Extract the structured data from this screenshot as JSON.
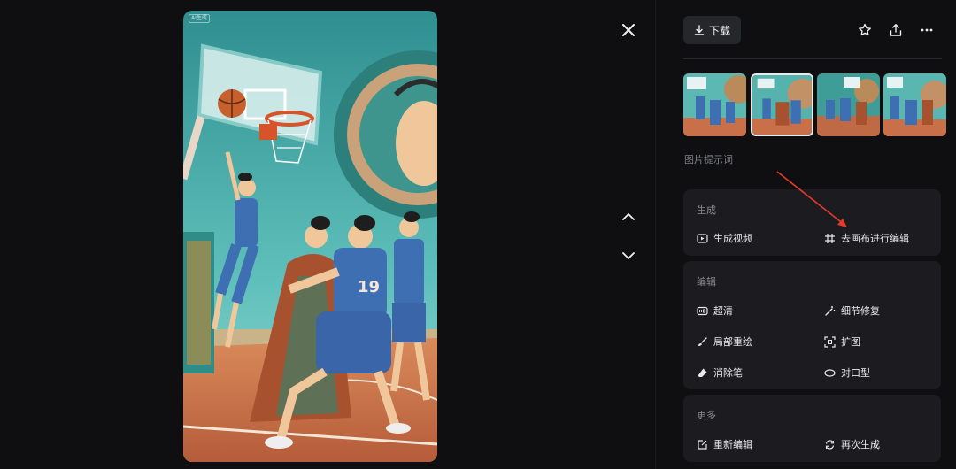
{
  "image": {
    "badge": "AI生成",
    "jersey_number": "19",
    "description_colors": {
      "sky": "#4fb3b0",
      "court": "#c8704a",
      "jersey": "#3f6fb3"
    }
  },
  "viewer": {
    "close_icon": "close-icon",
    "prev_icon": "chevron-up-icon",
    "next_icon": "chevron-down-icon"
  },
  "toolbar": {
    "download_label": "下载",
    "favorite_icon": "star-icon",
    "share_icon": "share-icon",
    "more_icon": "more-icon"
  },
  "thumbnails": [
    {
      "selected": false
    },
    {
      "selected": true
    },
    {
      "selected": false
    },
    {
      "selected": false
    }
  ],
  "prompt_label": "图片提示词",
  "sections": {
    "generate": {
      "title": "生成",
      "items": [
        "生成视频",
        "去画布进行编辑"
      ]
    },
    "edit": {
      "title": "编辑",
      "items": [
        "超清",
        "细节修复",
        "局部重绘",
        "扩图",
        "消除笔",
        "对口型"
      ]
    },
    "more": {
      "title": "更多",
      "items": [
        "重新编辑",
        "再次生成"
      ]
    }
  },
  "colors": {
    "background": "#0f0f11",
    "card": "#1c1c20",
    "annotation_arrow": "#e5392b"
  }
}
